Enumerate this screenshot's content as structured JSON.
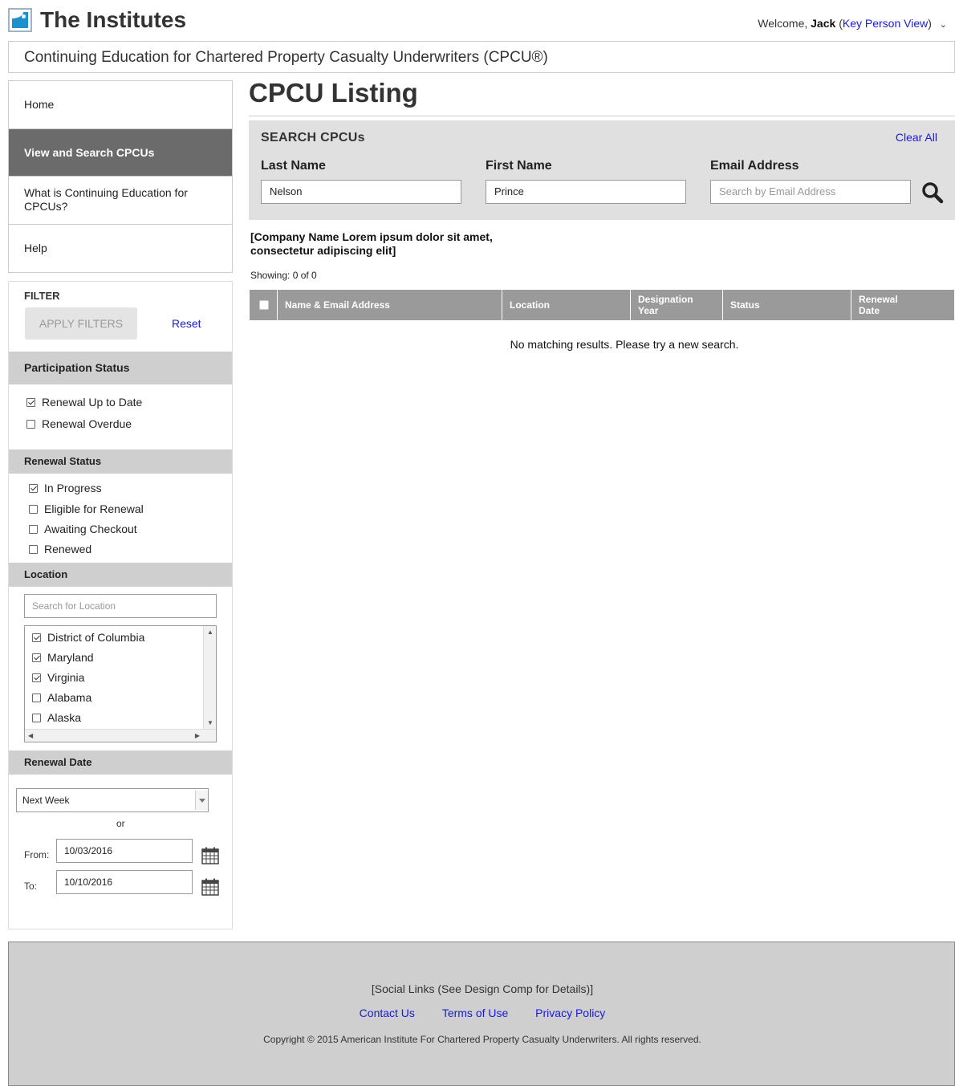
{
  "header": {
    "brand": "The Institutes",
    "welcome_prefix": "Welcome,",
    "user_name": "Jack",
    "paren_open": "(",
    "view_link": "Key Person View",
    "paren_close": ")"
  },
  "subtitle": "Continuing Education for Chartered Property Casualty Underwriters (CPCU®)",
  "nav": {
    "items": [
      {
        "label": "Home"
      },
      {
        "label": "View and Search CPCUs"
      },
      {
        "label": "What is Continuing Education for CPCUs?"
      },
      {
        "label": "Help"
      }
    ]
  },
  "filter": {
    "title": "FILTER",
    "apply_label": "APPLY FILTERS",
    "reset_label": "Reset",
    "participation": {
      "title": "Participation Status",
      "options": [
        {
          "label": "Renewal Up to Date",
          "checked": true
        },
        {
          "label": "Renewal Overdue",
          "checked": false
        }
      ]
    },
    "renewal_status": {
      "title": "Renewal Status",
      "options": [
        {
          "label": "In Progress",
          "checked": true
        },
        {
          "label": "Eligible for Renewal",
          "checked": false
        },
        {
          "label": "Awaiting Checkout",
          "checked": false
        },
        {
          "label": "Renewed",
          "checked": false
        }
      ]
    },
    "location": {
      "title": "Location",
      "search_placeholder": "Search for Location",
      "options": [
        {
          "label": "District of Columbia",
          "checked": true
        },
        {
          "label": "Maryland",
          "checked": true
        },
        {
          "label": "Virginia",
          "checked": true
        },
        {
          "label": "Alabama",
          "checked": false
        },
        {
          "label": "Alaska",
          "checked": false
        }
      ]
    },
    "renewal_date": {
      "title": "Renewal Date",
      "selected": "Next Week",
      "or_label": "or",
      "from_label": "From:",
      "from_value": "10/03/2016",
      "to_label": "To:",
      "to_value": "10/10/2016"
    }
  },
  "main": {
    "title": "CPCU Listing",
    "search": {
      "title": "SEARCH CPCUs",
      "clear_all": "Clear All",
      "last_name_label": "Last Name",
      "last_name_value": "Nelson",
      "first_name_label": "First Name",
      "first_name_value": "Prince",
      "email_label": "Email Address",
      "email_placeholder": "Search by Email Address"
    },
    "company": "[Company Name Lorem ipsum dolor sit amet, consectetur adipiscing elit]",
    "showing": "Showing: 0 of 0",
    "columns": [
      "Name & Email Address",
      "Location",
      "Designation Year",
      "Status",
      "Renewal Date"
    ],
    "no_results": "No matching results. Please try a new search."
  },
  "footer": {
    "social": "[Social Links (See Design Comp for Details)]",
    "links": [
      "Contact Us",
      "Terms of Use",
      "Privacy Policy"
    ],
    "copyright": "Copyright © 2015 American Institute For Chartered Property Casualty Underwriters. All rights reserved."
  }
}
